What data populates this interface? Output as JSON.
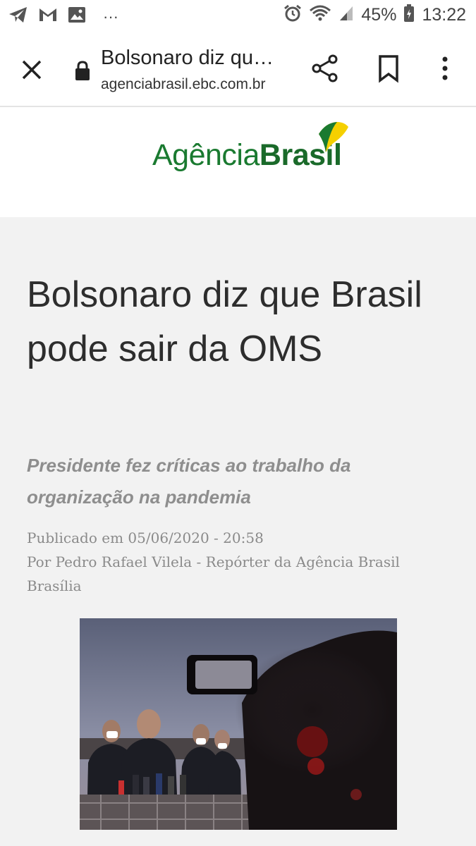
{
  "status_bar": {
    "battery_percent": "45%",
    "time": "13:22",
    "overflow_dots": "···",
    "left_icons": [
      "telegram-icon",
      "gmail-icon",
      "gallery-icon"
    ],
    "right_icons": [
      "alarm-icon",
      "wifi-icon",
      "signal-icon",
      "battery-icon"
    ]
  },
  "toolbar": {
    "page_title": "Bolsonaro diz qu…",
    "url": "agenciabrasil.ebc.com.br",
    "icons": [
      "close-icon",
      "lock-icon",
      "share-icon",
      "bookmark-icon",
      "more-vert-icon"
    ]
  },
  "logo": {
    "text_regular": "Agência",
    "text_bold": "Brasil",
    "colors": {
      "green": "#1a7a30",
      "yellow": "#f5d000"
    }
  },
  "article": {
    "headline": "Bolsonaro diz que Brasil pode sair da OMS",
    "subtitle": "Presidente fez críticas ao trabalho da organização na pandemia",
    "published": "Publicado em 05/06/2020 - 20:58",
    "byline": "Por Pedro Rafael Vilela - Repórter da Agência Brasil",
    "location": "Brasília"
  },
  "colors": {
    "page_background": "#f2f2f2",
    "bar_background": "#ffffff",
    "headline": "#2d2d2d",
    "subtitle": "#8e8e8e",
    "meta": "#8a8a8a"
  }
}
